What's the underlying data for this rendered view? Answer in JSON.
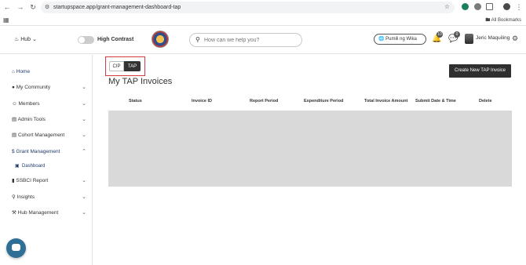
{
  "browser": {
    "url": "startupspace.app/grant-management-dashboard-tap",
    "all_bookmarks": "All Bookmarks"
  },
  "header": {
    "hub_label": "Hub",
    "high_contrast_label": "High Contrast",
    "search_placeholder": "How can we help you?",
    "language": "Pumili ng Wika",
    "notifications_count": "10",
    "messages_count": "0",
    "user_name": "Jeric Maquiling"
  },
  "sidebar": {
    "items": [
      {
        "label": "Home",
        "icon": "home-icon"
      },
      {
        "label": "My Community",
        "icon": "community-icon"
      },
      {
        "label": "Members",
        "icon": "members-icon"
      },
      {
        "label": "Admin Tools",
        "icon": "admin-tools-icon"
      },
      {
        "label": "Cohort Management",
        "icon": "cohort-icon"
      },
      {
        "label": "Grant Management",
        "icon": "dollar-icon"
      },
      {
        "label": "SSBCI Report",
        "icon": "report-icon"
      },
      {
        "label": "Insights",
        "icon": "insights-icon"
      },
      {
        "label": "Hub Management",
        "icon": "wrench-icon"
      }
    ],
    "sub_item": "Dashboard"
  },
  "main": {
    "tabs": [
      "CIP",
      "TAP"
    ],
    "active_tab": "TAP",
    "title": "My TAP Invoices",
    "create_button": "Create New TAP Invoice",
    "columns": [
      "Status",
      "Invoice ID",
      "Report Period",
      "Expenditure Period",
      "Total Invoice Amount",
      "Submit Date & Time",
      "Delete"
    ]
  },
  "colors": {
    "accent_dark": "#2f2f2f",
    "highlight_red": "#d23c3c",
    "sidebar_active": "#1f3a6b"
  }
}
